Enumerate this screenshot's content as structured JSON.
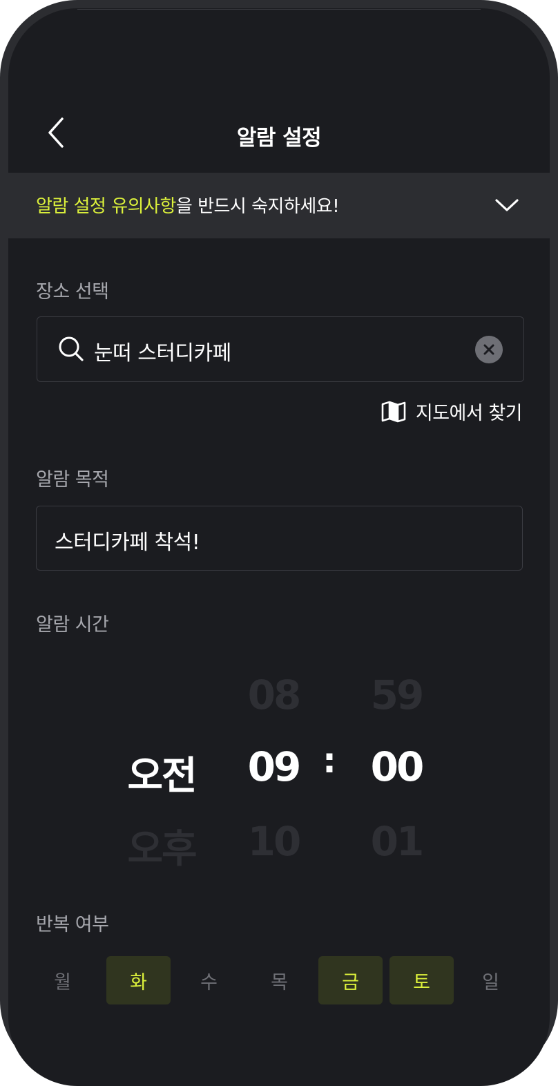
{
  "header": {
    "title": "알람 설정"
  },
  "notice": {
    "highlight": "알람 설정 유의사항",
    "rest": "을 반드시 숙지하세요!"
  },
  "place": {
    "label": "장소 선택",
    "value": "눈떠 스터디카페",
    "map_link": "지도에서 찾기"
  },
  "purpose": {
    "label": "알람 목적",
    "value": "스터디카페 착석!"
  },
  "time": {
    "label": "알람 시간",
    "ampm": {
      "prev": "",
      "current": "오전",
      "next": "오후"
    },
    "hour": {
      "prev": "08",
      "current": "09",
      "next": "10"
    },
    "separator": ":",
    "minute": {
      "prev": "59",
      "current": "00",
      "next": "01"
    }
  },
  "repeat": {
    "label": "반복 여부",
    "days": [
      {
        "label": "월",
        "selected": false
      },
      {
        "label": "화",
        "selected": true
      },
      {
        "label": "수",
        "selected": false
      },
      {
        "label": "목",
        "selected": false
      },
      {
        "label": "금",
        "selected": true
      },
      {
        "label": "토",
        "selected": true
      },
      {
        "label": "일",
        "selected": false
      }
    ]
  },
  "colors": {
    "accent": "#ddf23b",
    "background": "#1b1c20",
    "surface": "#2c2d31",
    "selected_day_bg": "#30351f"
  },
  "icons": {
    "back": "chevron-left-icon",
    "notice_toggle": "chevron-down-icon",
    "search": "search-icon",
    "clear": "close-icon",
    "map": "map-icon"
  }
}
